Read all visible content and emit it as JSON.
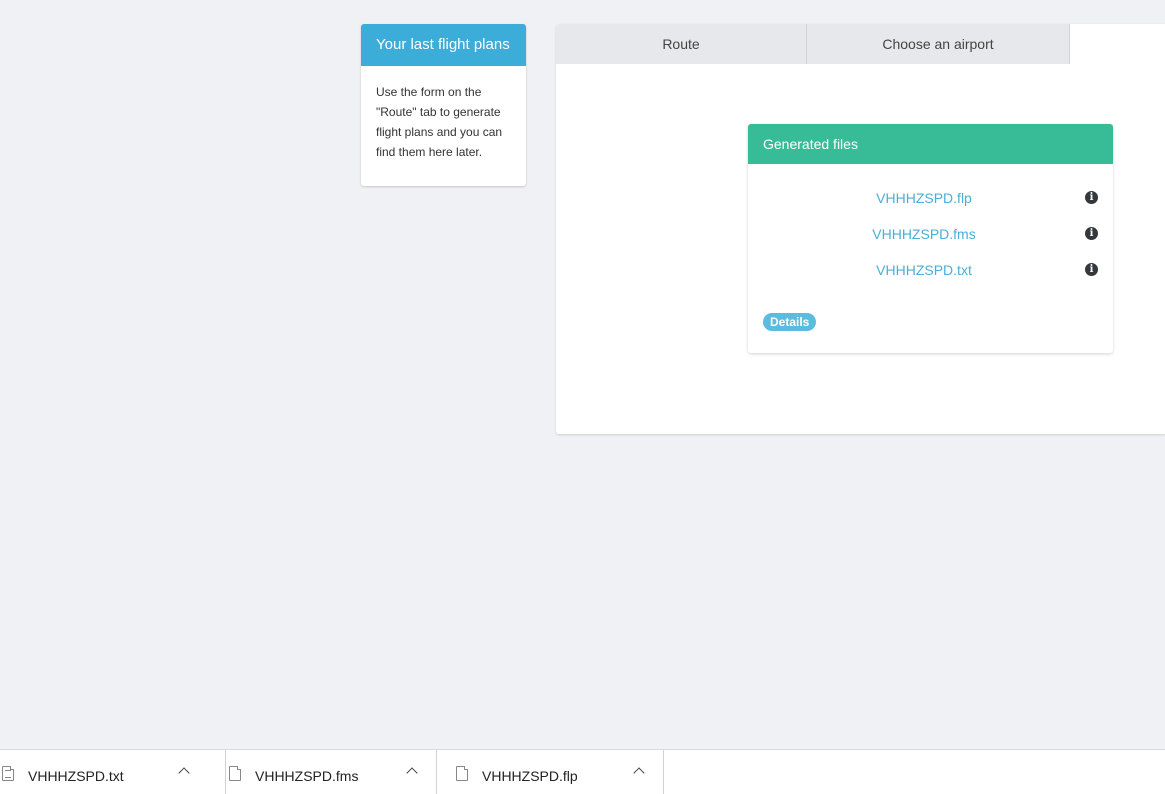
{
  "last_flight_plans": {
    "title": "Your last flight plans",
    "description": "Use the form on the \"Route\" tab to generate flight plans and you can find them here later."
  },
  "tabs": [
    {
      "label": "Route"
    },
    {
      "label": "Choose an airport"
    }
  ],
  "generated_files": {
    "title": "Generated files",
    "files": [
      {
        "name": "VHHHZSPD.flp",
        "icon": "info-icon"
      },
      {
        "name": "VHHHZSPD.fms",
        "icon": "info-icon"
      },
      {
        "name": "VHHHZSPD.txt",
        "icon": "info-icon"
      }
    ],
    "details_label": "Details"
  },
  "download_bar": {
    "items": [
      {
        "name": "VHHHZSPD.txt",
        "icon": "text-file-icon"
      },
      {
        "name": "VHHHZSPD.fms",
        "icon": "file-icon"
      },
      {
        "name": "VHHHZSPD.flp",
        "icon": "file-icon"
      }
    ]
  },
  "colors": {
    "flight_plans_header": "#3cacd9",
    "generated_files_header": "#38bc98",
    "link": "#4aaed8",
    "details_badge": "#5bbcdd"
  }
}
